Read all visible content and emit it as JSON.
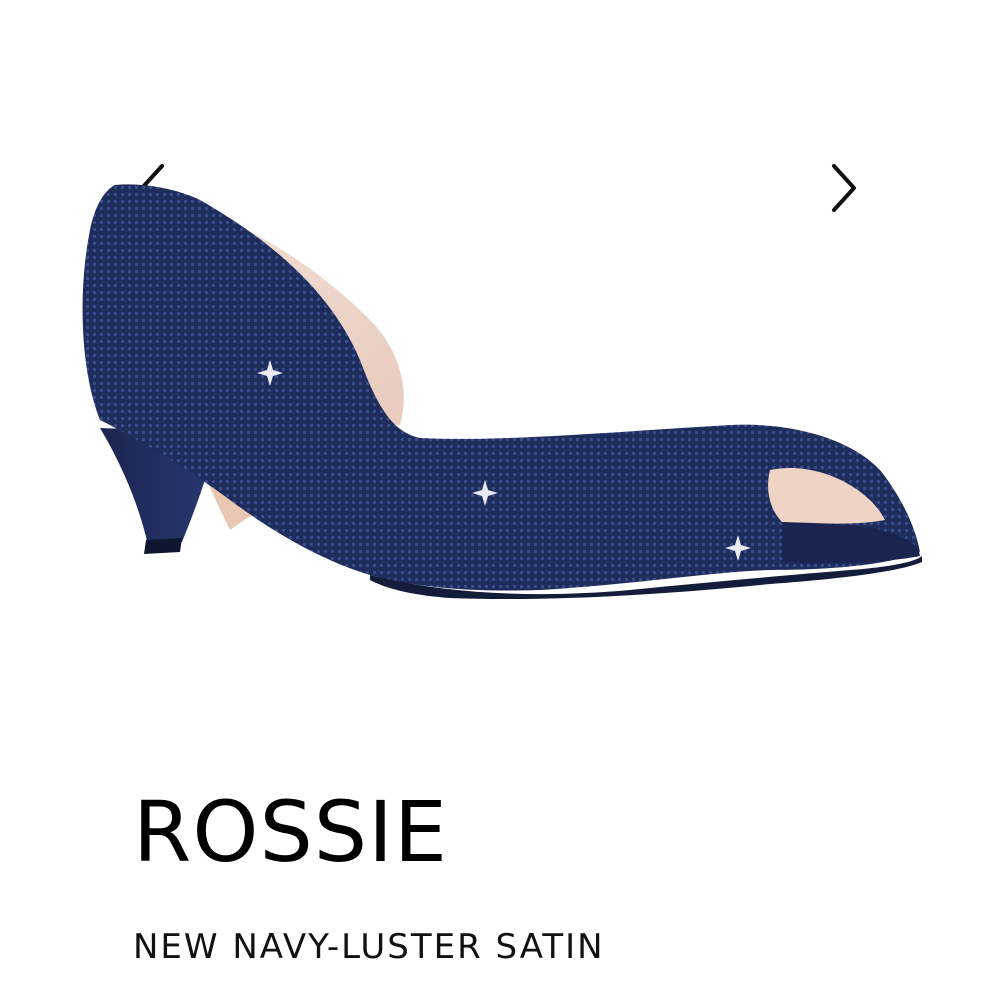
{
  "gallery": {
    "image_subject": "navy rhinestone peep-toe low-heel pump",
    "prev_icon": "chevron-left-icon",
    "next_icon": "chevron-right-icon"
  },
  "product": {
    "name": "ROSSIE",
    "color": "NEW NAVY-LUSTER SATIN"
  },
  "colors": {
    "shoe_navy": "#1f2d5c",
    "lining_pink": "#f1dcd3",
    "text": "#000000",
    "background": "#ffffff"
  }
}
